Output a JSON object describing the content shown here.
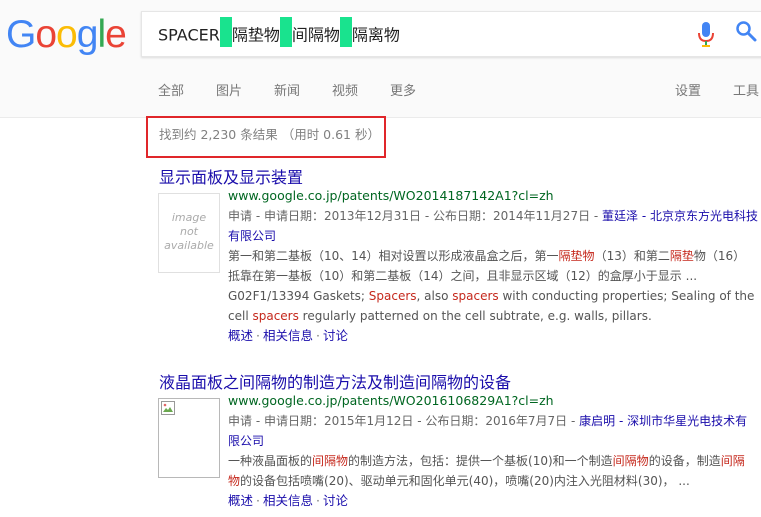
{
  "logo": {
    "text": "Google"
  },
  "search": {
    "query_parts": [
      "SPACER",
      "隔垫物",
      "间隔物",
      "隔离物"
    ],
    "highlight_color": "#19e38e"
  },
  "tabs": [
    {
      "label": "全部"
    },
    {
      "label": "图片"
    },
    {
      "label": "新闻"
    },
    {
      "label": "视频"
    },
    {
      "label": "更多"
    },
    {
      "label": "设置"
    },
    {
      "label": "工具"
    }
  ],
  "stats": {
    "text": "找到约 2,230 条结果 （用时 0.61 秒）"
  },
  "results": [
    {
      "title": "显示面板及显示装置",
      "url": "www.google.co.jp/patents/WO2014187142A1?cl=zh",
      "thumbnail_text": [
        "image",
        "not",
        "available"
      ],
      "meta_prefix": "申请 - 申请日期：2013年12月31日 - 公布日期：2014年11月27日 - ",
      "meta_who": "董廷泽 - 北京京东方光电科技有限公司",
      "snippet": [
        {
          "t": "第一和第二基板（10、14）相对设置以形成液晶盒之后，第一"
        },
        {
          "t": "隔垫物",
          "em": true
        },
        {
          "t": "（13）和第二"
        },
        {
          "t": "隔垫",
          "em": true
        },
        {
          "t": "物（16）抵靠在第一基板（10）和第二基板（14）之间，且非显示区域（12）的盒厚小于显示 ... G02F1/13394 Gaskets; "
        },
        {
          "t": "Spacers",
          "em": true
        },
        {
          "t": ", also "
        },
        {
          "t": "spacers",
          "em": true
        },
        {
          "t": " with conducting properties; Sealing of the cell "
        },
        {
          "t": "spacers",
          "em": true
        },
        {
          "t": " regularly patterned on the cell subtrate, e.g. walls, pillars."
        }
      ],
      "links": [
        "概述",
        "相关信息",
        "讨论"
      ]
    },
    {
      "title": "液晶面板之间隔物的制造方法及制造间隔物的设备",
      "url": "www.google.co.jp/patents/WO2016106829A1?cl=zh",
      "meta_prefix": "申请 - 申请日期：2015年1月12日 - 公布日期：2016年7月7日 - ",
      "meta_who": "康启明 - 深圳市华星光电技术有限公司",
      "snippet": [
        {
          "t": "一种液晶面板的"
        },
        {
          "t": "间隔物",
          "em": true
        },
        {
          "t": "的制造方法，包括：提供一个基板(10)和一个制造"
        },
        {
          "t": "间隔物",
          "em": true
        },
        {
          "t": "的设备，制造"
        },
        {
          "t": "间隔物",
          "em": true
        },
        {
          "t": "的设备包括喷嘴(20)、驱动单元和固化单元(40)，喷嘴(20)内注入光阻材料(30)， ..."
        }
      ],
      "links": [
        "概述",
        "相关信息",
        "讨论"
      ]
    }
  ]
}
